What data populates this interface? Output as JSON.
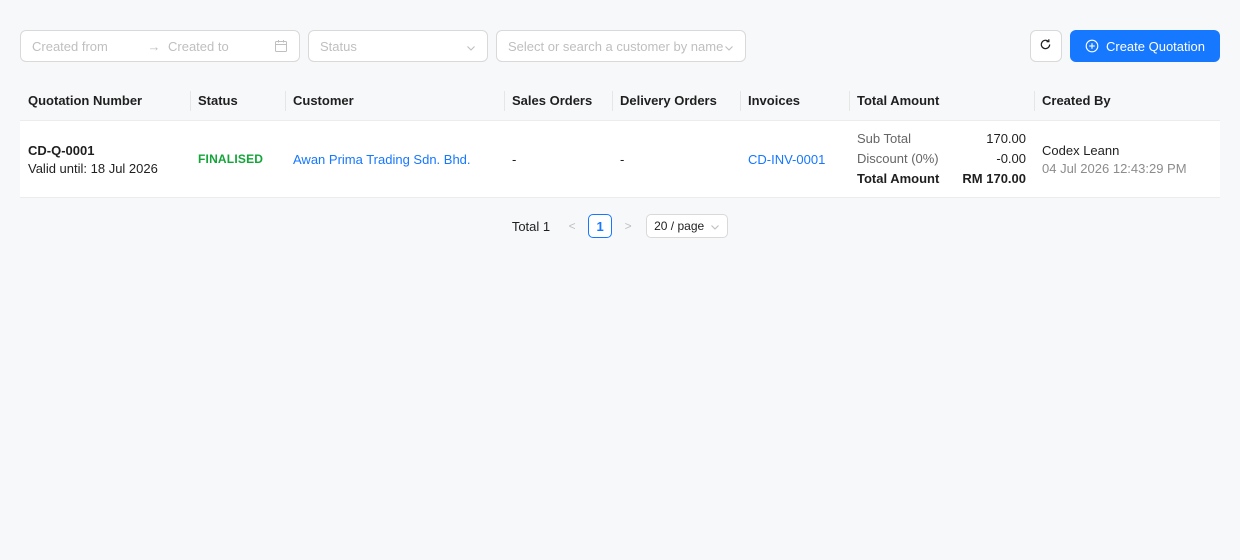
{
  "filters": {
    "created_from_placeholder": "Created from",
    "created_to_placeholder": "Created to",
    "range_separator": "→",
    "status_placeholder": "Status",
    "customer_placeholder": "Select or search a customer by name"
  },
  "actions": {
    "create_label": "Create Quotation"
  },
  "table": {
    "columns": [
      "Quotation Number",
      "Status",
      "Customer",
      "Sales Orders",
      "Delivery Orders",
      "Invoices",
      "Total Amount",
      "Created By"
    ],
    "rows": [
      {
        "quotation_number": "CD-Q-0001",
        "valid_until": "Valid until: 18 Jul 2026",
        "status": "FINALISED",
        "customer": "Awan Prima Trading Sdn. Bhd.",
        "sales_orders": "-",
        "delivery_orders": "-",
        "invoice": "CD-INV-0001",
        "sub_total_label": "Sub Total",
        "sub_total": "170.00",
        "discount_label": "Discount (0%)",
        "discount": "-0.00",
        "total_label": "Total Amount",
        "total": "RM 170.00",
        "created_by": "Codex Leann",
        "created_at": "04 Jul 2026 12:43:29 PM"
      }
    ]
  },
  "pagination": {
    "total_text": "Total 1",
    "prev": "<",
    "current_page": "1",
    "next": ">",
    "page_size": "20 / page"
  },
  "colors": {
    "primary": "#1677ff",
    "status_finalised": "#13a538"
  }
}
